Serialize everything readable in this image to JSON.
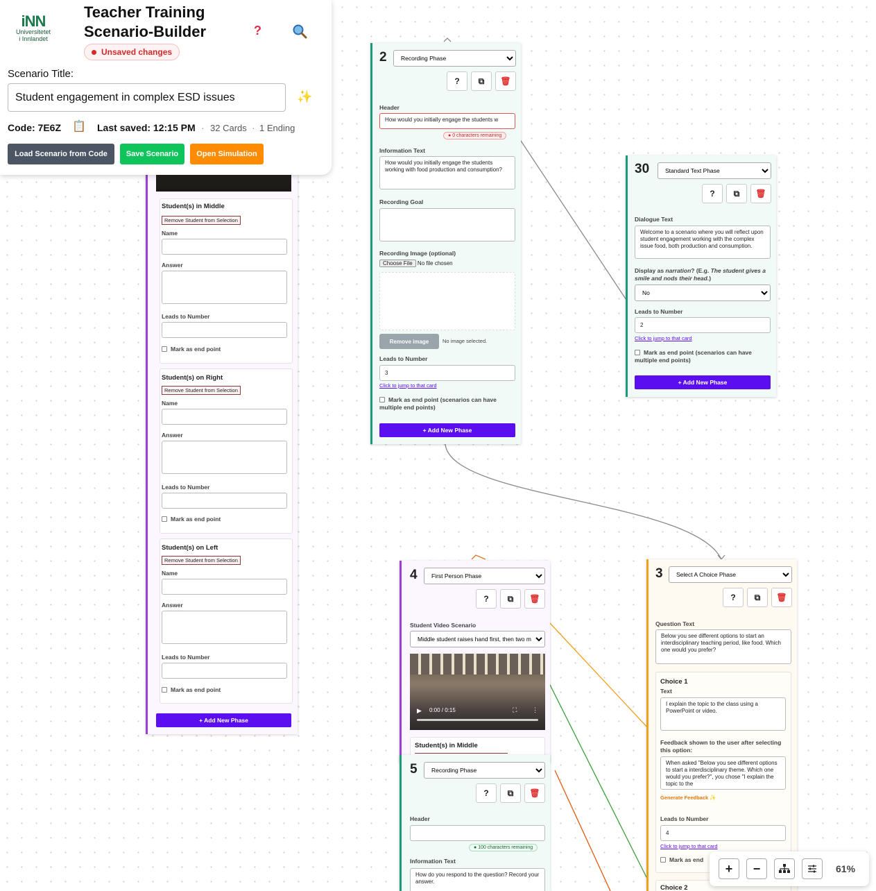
{
  "app": {
    "logo_text": "iNN",
    "logo_sub1": "Universitetet",
    "logo_sub2": "i Innlandet",
    "title_line1": "Teacher Training",
    "title_line2": "Scenario-Builder",
    "help_icon": "question-mark-icon",
    "search_icon": "magnifier-icon",
    "unsaved_badge": "Unsaved changes",
    "scenario_title_label": "Scenario Title:",
    "scenario_title_value": "Student engagement in complex ESD issues",
    "code_label": "Code: 7E6Z",
    "last_saved": "Last saved: 12:15 PM",
    "cards_count": "32 Cards",
    "endings_count": "1 Ending",
    "buttons": {
      "load": "Load Scenario from Code",
      "save": "Save Scenario",
      "open": "Open Simulation"
    },
    "colors": {
      "load": "#4b5563",
      "save": "#10c45c",
      "open": "#ff8c00",
      "add_phase": "#5b0ef0",
      "unsaved_text": "#d22a2a"
    }
  },
  "common": {
    "help_btn": "?",
    "add_phase": "+ Add New Phase",
    "leads_to": "Leads to Number",
    "jump_link": "Click to jump to that card",
    "end_point_long": "Mark as end point (scenarios can have multiple end points)",
    "end_point_short": "Mark as end point",
    "remove_student": "Remove Student from Selection",
    "name": "Name",
    "answer": "Answer"
  },
  "left_card": {
    "sections": [
      {
        "title": "Student(s) in Middle"
      },
      {
        "title": "Student(s) on Right"
      },
      {
        "title": "Student(s) on Left"
      }
    ]
  },
  "card2": {
    "number": "2",
    "phase_type": "Recording Phase",
    "header_label": "Header",
    "header_value": "How would you initially engage the students w",
    "chars_remaining": "0 characters remaining",
    "info_label": "Information Text",
    "info_value": "How would you initially engage the students working with food production and consumption?",
    "goal_label": "Recording Goal",
    "image_label": "Recording Image (optional)",
    "choose_file": "Choose File",
    "no_file": "No file chosen",
    "remove_image": "Remove image",
    "no_image": "No image selected.",
    "leads_value": "3"
  },
  "card30": {
    "number": "30",
    "phase_type": "Standard Text Phase",
    "dialogue_label": "Dialogue Text",
    "dialogue_value": "Welcome to a scenario where you will reflect upon student engagement working with the complex issue food, both production and consumption.",
    "narration_prefix": "Display as ",
    "narration_em": "narration",
    "narration_mid": "? (E.g. ",
    "narration_example": "The student gives a smile and nods their head.",
    "narration_end": ")",
    "narration_value": "No",
    "leads_value": "2"
  },
  "card4": {
    "number": "4",
    "phase_type": "First Person Phase",
    "video_label": "Student Video Scenario",
    "video_value": "Middle student raises hand first, then two m",
    "video_time": "0:00 / 0:15",
    "section_title": "Student(s) in Middle"
  },
  "card5": {
    "number": "5",
    "phase_type": "Recording Phase",
    "header_label": "Header",
    "chars_remaining": "100 characters remaining",
    "info_label": "Information Text",
    "info_value": "How do you respond to the question? Record your answer."
  },
  "card3": {
    "number": "3",
    "phase_type": "Select A Choice Phase",
    "question_label": "Question Text",
    "question_value": "Below you see different options to start an interdisciplinary teaching period, like food. Which one would you prefer?",
    "choice1_title": "Choice 1",
    "text_label": "Text",
    "choice1_text": "I explain the topic to the class using a PowerPoint or video.",
    "feedback_label": "Feedback shown to the user after selecting this option:",
    "feedback_value": "When asked \"Below you see different options to start a interdisciplinary theme. Which one would you prefer?\", you chose \"I explain the topic to the",
    "generate_feedback": "Generate Feedback",
    "leads_value": "4",
    "end_trunc": "Mark as end",
    "choice2_title": "Choice 2"
  },
  "zoom": {
    "plus": "+",
    "minus": "−",
    "level": "61%"
  }
}
